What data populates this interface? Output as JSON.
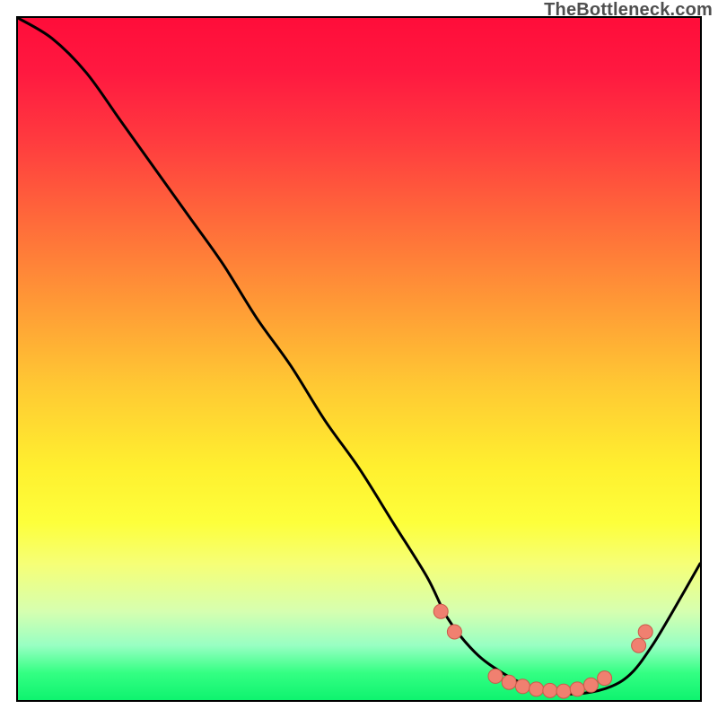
{
  "watermark": "TheBottleneck.com",
  "colors": {
    "curve": "#000000",
    "marker_fill": "#f08070",
    "marker_stroke": "#c95a4a",
    "border": "#000000"
  },
  "chart_data": {
    "type": "line",
    "title": "",
    "xlabel": "",
    "ylabel": "",
    "xlim": [
      0,
      100
    ],
    "ylim": [
      0,
      100
    ],
    "note": "No axis ticks or numeric labels are visible; x/y are normalized 0-100 across the plot area. 'values' are estimated heights of the black curve. 'markers' are the salmon dot positions on the curve near its minimum.",
    "x": [
      0,
      5,
      10,
      15,
      20,
      25,
      30,
      35,
      40,
      45,
      50,
      55,
      60,
      63,
      67,
      71,
      75,
      79,
      83,
      87,
      90,
      93,
      96,
      100
    ],
    "values": [
      100,
      97,
      92,
      85,
      78,
      71,
      64,
      56,
      49,
      41,
      34,
      26,
      18,
      12,
      7,
      4,
      2,
      1,
      1,
      2,
      4,
      8,
      13,
      20
    ],
    "markers": [
      {
        "x": 62,
        "y": 13
      },
      {
        "x": 64,
        "y": 10
      },
      {
        "x": 70,
        "y": 3.5
      },
      {
        "x": 72,
        "y": 2.6
      },
      {
        "x": 74,
        "y": 2.0
      },
      {
        "x": 76,
        "y": 1.6
      },
      {
        "x": 78,
        "y": 1.4
      },
      {
        "x": 80,
        "y": 1.3
      },
      {
        "x": 82,
        "y": 1.6
      },
      {
        "x": 84,
        "y": 2.2
      },
      {
        "x": 86,
        "y": 3.2
      },
      {
        "x": 91,
        "y": 8.0
      },
      {
        "x": 92,
        "y": 10.0
      }
    ]
  }
}
